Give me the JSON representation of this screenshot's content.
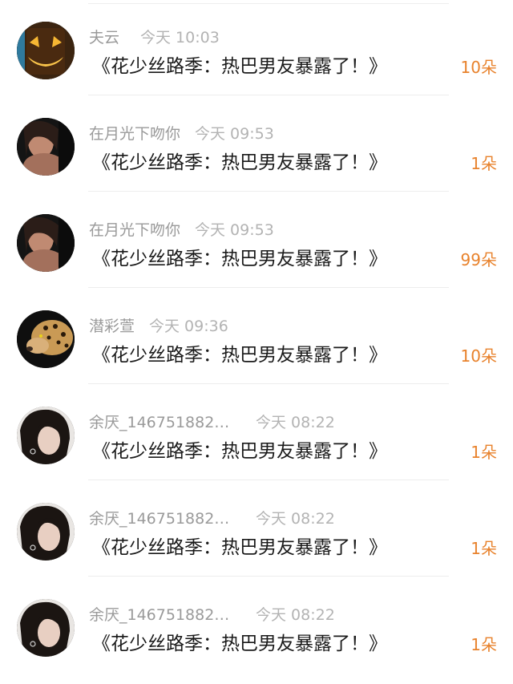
{
  "comments": [
    {
      "user": "夫云",
      "time": "今天 10:03",
      "message": "《花少丝路季：热巴男友暴露了！》",
      "count": "10朵",
      "avatar": "pumpkin-avatar"
    },
    {
      "user": "在月光下吻你",
      "time": "今天 09:53",
      "message": "《花少丝路季：热巴男友暴露了！》",
      "count": "1朵",
      "avatar": "dark-portrait-avatar"
    },
    {
      "user": "在月光下吻你",
      "time": "今天 09:53",
      "message": "《花少丝路季：热巴男友暴露了！》",
      "count": "99朵",
      "avatar": "dark-portrait-avatar"
    },
    {
      "user": "潜彩萱",
      "time": "今天 09:36",
      "message": "《花少丝路季：热巴男友暴露了！》",
      "count": "10朵",
      "avatar": "leopard-avatar"
    },
    {
      "user": "余厌_1467518821...",
      "time": "今天 08:22",
      "message": "《花少丝路季：热巴男友暴露了！》",
      "count": "1朵",
      "avatar": "girl-portrait-avatar"
    },
    {
      "user": "余厌_1467518821...",
      "time": "今天 08:22",
      "message": "《花少丝路季：热巴男友暴露了！》",
      "count": "1朵",
      "avatar": "girl-portrait-avatar"
    },
    {
      "user": "余厌_1467518821...",
      "time": "今天 08:22",
      "message": "《花少丝路季：热巴男友暴露了！》",
      "count": "1朵",
      "avatar": "girl-portrait-avatar"
    }
  ],
  "colors": {
    "count": "#e8822c",
    "username": "#9a9a9a",
    "time": "#b3b3b3",
    "message": "#1a1a1a",
    "divider": "#ededed"
  }
}
